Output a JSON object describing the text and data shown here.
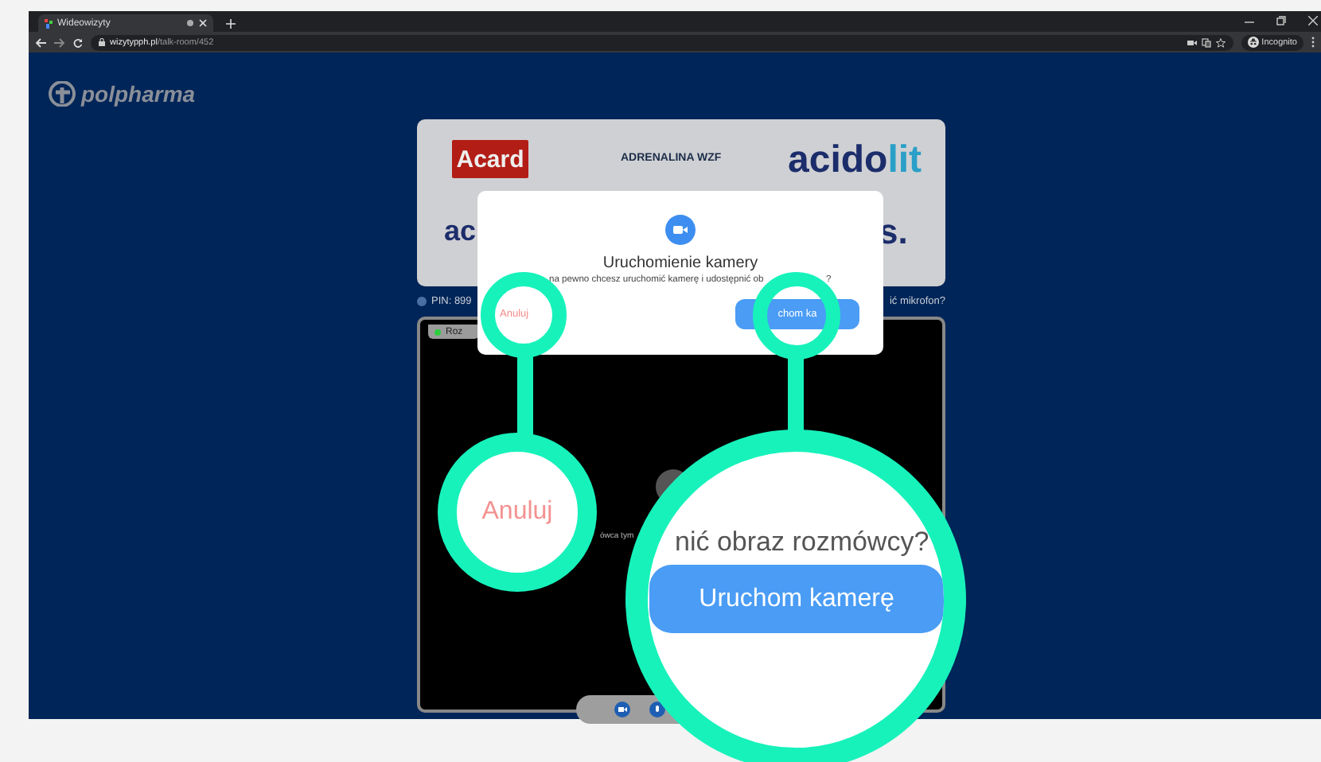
{
  "browser": {
    "tab_title": "Wideowizyty",
    "url_domain": "wizytypph.pl",
    "url_path": "/talk-room/452",
    "profile": "Incognito"
  },
  "page": {
    "logo": "polpharma",
    "sponsors": [
      {
        "kind": "acard",
        "text": "Acard"
      },
      {
        "kind": "adrenalina",
        "text": "ADRENALINA WZF"
      },
      {
        "kind": "acidolit",
        "text": "acido",
        "accent": "lit"
      },
      {
        "kind": "partial-left",
        "text": "ac"
      },
      {
        "kind": "partial-right",
        "text": "s."
      }
    ],
    "pin": "PIN: 899",
    "mic_prompt": "ić mikrofon?",
    "status_tag": "Roz",
    "video_text": "ówca tym"
  },
  "dialog": {
    "title": "Uruchomienie kamery",
    "message": "na pewno chcesz uruchomić kamerę i udostępnić ob",
    "message_end": "?",
    "cancel": "Anuluj",
    "confirm": "chom ka"
  },
  "callouts": {
    "cancel_zoom": {
      "label": "Anuluj"
    },
    "confirm_zoom": {
      "message": "nić obraz rozmówcy?",
      "button": "Uruchom kamerę"
    }
  }
}
